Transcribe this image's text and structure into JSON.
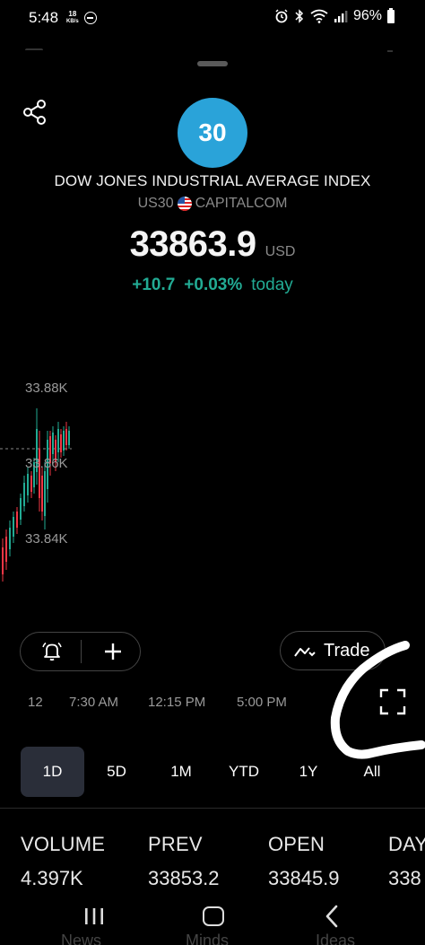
{
  "status_bar": {
    "time": "5:48",
    "speed_value": "18",
    "speed_unit": "KB/s",
    "battery": "96%",
    "icons": [
      "dnd-icon",
      "alarm-icon",
      "bluetooth-icon",
      "wifi-icon",
      "signal-icon",
      "battery-icon"
    ]
  },
  "instrument": {
    "logo_text": "30",
    "name": "DOW JONES INDUSTRIAL AVERAGE INDEX",
    "symbol": "US30",
    "exchange": "CAPITALCOM",
    "price": "33863.9",
    "currency": "USD",
    "change": "+10.7",
    "change_percent": "+0.03%",
    "change_period": "today"
  },
  "colors": {
    "accent_blue": "#2aa3d9",
    "positive": "#22ab94",
    "negative": "#f23645",
    "background": "#000000",
    "active_tab": "#2a2e39"
  },
  "chart": {
    "y_labels": [
      "33.88K",
      "33.86K",
      "33.84K"
    ],
    "time_labels": [
      "12",
      "7:30 AM",
      "12:15 PM",
      "5:00 PM"
    ]
  },
  "actions": {
    "alert_icon": "bell-plus-icon",
    "add_icon": "plus-icon",
    "trade_label": "Trade",
    "fullscreen_icon": "fullscreen-icon"
  },
  "periods": [
    {
      "label": "1D",
      "active": true
    },
    {
      "label": "5D",
      "active": false
    },
    {
      "label": "1M",
      "active": false
    },
    {
      "label": "YTD",
      "active": false
    },
    {
      "label": "1Y",
      "active": false
    },
    {
      "label": "All",
      "active": false
    }
  ],
  "stats": [
    {
      "label": "VOLUME",
      "value": "4.397K"
    },
    {
      "label": "PREV",
      "value": "33853.2"
    },
    {
      "label": "OPEN",
      "value": "33845.9"
    },
    {
      "label": "DAY",
      "value": "338"
    }
  ],
  "bottom_tabs": [
    "News",
    "Minds",
    "Ideas"
  ]
}
